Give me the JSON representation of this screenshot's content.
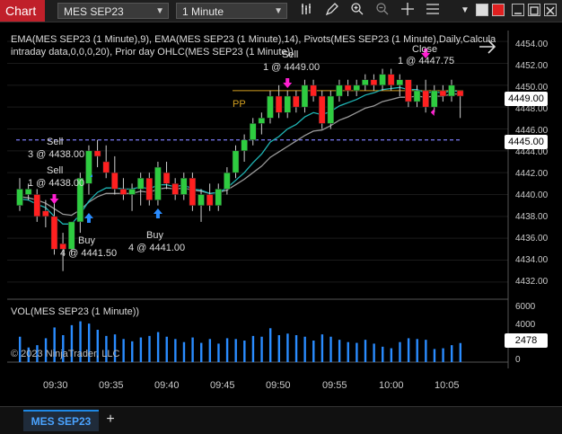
{
  "app": {
    "title": "Chart"
  },
  "toolbar": {
    "instrument": "MES SEP23",
    "interval": "1 Minute"
  },
  "overlays": {
    "indicators_line1": "EMA(MES SEP23 (1 Minute),9), EMA(MES SEP23 (1 Minute),14), Pivots(MES SEP23 (1 Minute),Daily,Calculated from",
    "indicators_line2": "intraday data,0,0,0,20), Prior day OHLC(MES SEP23 (1 Minute))",
    "copyright": "© 2023 NinjaTrader, LLC",
    "vol_label": "VOL(MES SEP23 (1 Minute))",
    "pp_label": "PP"
  },
  "trades": [
    {
      "action": "Sell",
      "detail": "3 @ 4438.00"
    },
    {
      "action": "Sell",
      "detail": "1 @ 4438.00"
    },
    {
      "action": "Buy",
      "detail": "4 @ 4441.50"
    },
    {
      "action": "Buy",
      "detail": "4 @ 4441.00"
    },
    {
      "action": "Sell",
      "detail": "1 @ 4449.00"
    },
    {
      "action": "Close",
      "detail": "1 @ 4447.75"
    }
  ],
  "price_axis": {
    "ticks": [
      "4454.00",
      "4452.00",
      "4450.00",
      "4448.00",
      "4446.00",
      "4444.00",
      "4442.00",
      "4440.00",
      "4438.00",
      "4436.00",
      "4434.00",
      "4432.00"
    ],
    "last_price": "4449.00",
    "level_price": "4445.00"
  },
  "volume_axis": {
    "ticks": [
      "6000",
      "4000",
      "2000",
      "0"
    ],
    "last_volume": "2478"
  },
  "time_axis": [
    "09:30",
    "09:35",
    "09:40",
    "09:45",
    "09:50",
    "09:55",
    "10:00",
    "10:05"
  ],
  "tabs": {
    "active": "MES SEP23",
    "add_label": "+"
  },
  "colors": {
    "up": "#2ecc40",
    "down": "#ff2020",
    "ema_fast": "#1fb5b5",
    "ema_slow": "#9a9a9a",
    "pivot": "#d4a020",
    "prior_level": "#7070e0",
    "sell_arrow": "#ff1fd1",
    "buy_arrow": "#2a8cff",
    "volume": "#2a8cff"
  },
  "chart_data": {
    "type": "candlestick",
    "ylim": [
      4431,
      4455
    ],
    "volume_ylim": [
      0,
      7000
    ],
    "pivot_level": 4449.5,
    "prior_day_level": 4445.0,
    "candles": [
      {
        "o": 4439.0,
        "h": 4441.5,
        "l": 4438.5,
        "c": 4440.5
      },
      {
        "o": 4440.0,
        "h": 4441.0,
        "l": 4439.5,
        "c": 4440.5
      },
      {
        "o": 4440.0,
        "h": 4440.5,
        "l": 4437.5,
        "c": 4438.0
      },
      {
        "o": 4438.5,
        "h": 4439.5,
        "l": 4437.0,
        "c": 4438.0
      },
      {
        "o": 4438.0,
        "h": 4439.5,
        "l": 4434.5,
        "c": 4435.0
      },
      {
        "o": 4435.5,
        "h": 4436.5,
        "l": 4433.0,
        "c": 4435.0
      },
      {
        "o": 4435.0,
        "h": 4437.5,
        "l": 4434.5,
        "c": 4437.5
      },
      {
        "o": 4437.5,
        "h": 4442.0,
        "l": 4436.5,
        "c": 4441.5
      },
      {
        "o": 4441.0,
        "h": 4444.5,
        "l": 4440.0,
        "c": 4444.0
      },
      {
        "o": 4444.0,
        "h": 4445.0,
        "l": 4442.5,
        "c": 4443.5
      },
      {
        "o": 4443.0,
        "h": 4444.5,
        "l": 4441.5,
        "c": 4442.0
      },
      {
        "o": 4442.0,
        "h": 4443.5,
        "l": 4440.0,
        "c": 4440.5
      },
      {
        "o": 4440.5,
        "h": 4441.5,
        "l": 4439.5,
        "c": 4440.0
      },
      {
        "o": 4440.0,
        "h": 4441.0,
        "l": 4438.5,
        "c": 4440.5
      },
      {
        "o": 4440.5,
        "h": 4442.0,
        "l": 4439.0,
        "c": 4441.5
      },
      {
        "o": 4441.5,
        "h": 4442.0,
        "l": 4439.0,
        "c": 4439.5
      },
      {
        "o": 4439.5,
        "h": 4443.0,
        "l": 4439.0,
        "c": 4442.5
      },
      {
        "o": 4442.0,
        "h": 4443.0,
        "l": 4440.5,
        "c": 4441.0
      },
      {
        "o": 4441.0,
        "h": 4441.5,
        "l": 4439.5,
        "c": 4440.0
      },
      {
        "o": 4440.0,
        "h": 4442.0,
        "l": 4439.5,
        "c": 4441.5
      },
      {
        "o": 4441.5,
        "h": 4442.0,
        "l": 4438.5,
        "c": 4439.0
      },
      {
        "o": 4439.0,
        "h": 4440.5,
        "l": 4437.5,
        "c": 4440.0
      },
      {
        "o": 4440.0,
        "h": 4441.0,
        "l": 4438.5,
        "c": 4439.0
      },
      {
        "o": 4439.0,
        "h": 4441.0,
        "l": 4438.5,
        "c": 4440.5
      },
      {
        "o": 4440.5,
        "h": 4442.5,
        "l": 4440.0,
        "c": 4442.0
      },
      {
        "o": 4442.0,
        "h": 4444.5,
        "l": 4441.5,
        "c": 4444.0
      },
      {
        "o": 4444.0,
        "h": 4445.5,
        "l": 4443.0,
        "c": 4445.0
      },
      {
        "o": 4445.0,
        "h": 4447.0,
        "l": 4444.5,
        "c": 4446.5
      },
      {
        "o": 4446.5,
        "h": 4447.5,
        "l": 4445.5,
        "c": 4447.0
      },
      {
        "o": 4447.0,
        "h": 4449.5,
        "l": 4446.5,
        "c": 4449.0
      },
      {
        "o": 4449.0,
        "h": 4450.0,
        "l": 4447.0,
        "c": 4447.5
      },
      {
        "o": 4447.5,
        "h": 4449.5,
        "l": 4447.0,
        "c": 4449.0
      },
      {
        "o": 4449.0,
        "h": 4449.5,
        "l": 4447.5,
        "c": 4448.0
      },
      {
        "o": 4448.0,
        "h": 4450.5,
        "l": 4447.5,
        "c": 4450.0
      },
      {
        "o": 4450.0,
        "h": 4450.5,
        "l": 4448.5,
        "c": 4449.0
      },
      {
        "o": 4449.0,
        "h": 4449.5,
        "l": 4446.0,
        "c": 4446.5
      },
      {
        "o": 4446.5,
        "h": 4449.5,
        "l": 4446.0,
        "c": 4449.0
      },
      {
        "o": 4449.0,
        "h": 4450.5,
        "l": 4448.5,
        "c": 4450.0
      },
      {
        "o": 4450.0,
        "h": 4450.5,
        "l": 4449.0,
        "c": 4449.5
      },
      {
        "o": 4449.5,
        "h": 4450.5,
        "l": 4449.0,
        "c": 4450.0
      },
      {
        "o": 4450.0,
        "h": 4451.0,
        "l": 4449.5,
        "c": 4450.5
      },
      {
        "o": 4450.5,
        "h": 4451.0,
        "l": 4449.5,
        "c": 4450.0
      },
      {
        "o": 4450.0,
        "h": 4451.5,
        "l": 4449.5,
        "c": 4451.0
      },
      {
        "o": 4451.0,
        "h": 4451.5,
        "l": 4449.5,
        "c": 4450.0
      },
      {
        "o": 4450.0,
        "h": 4451.0,
        "l": 4449.0,
        "c": 4450.5
      },
      {
        "o": 4450.5,
        "h": 4450.5,
        "l": 4448.0,
        "c": 4448.5
      },
      {
        "o": 4448.5,
        "h": 4450.0,
        "l": 4448.0,
        "c": 4449.5
      },
      {
        "o": 4449.5,
        "h": 4450.5,
        "l": 4447.5,
        "c": 4448.0
      },
      {
        "o": 4448.0,
        "h": 4450.0,
        "l": 4447.5,
        "c": 4449.5
      },
      {
        "o": 4449.5,
        "h": 4450.0,
        "l": 4448.5,
        "c": 4449.0
      },
      {
        "o": 4449.0,
        "h": 4450.5,
        "l": 4448.5,
        "c": 4450.0
      },
      {
        "o": 4449.5,
        "h": 4449.5,
        "l": 4447.0,
        "c": 4449.0
      }
    ],
    "volumes": [
      3300,
      1900,
      2200,
      3100,
      4500,
      3500,
      4800,
      5300,
      5000,
      4200,
      3400,
      3600,
      3000,
      2700,
      3200,
      3400,
      3900,
      3300,
      3000,
      2600,
      3200,
      2500,
      3000,
      2400,
      3100,
      3000,
      2800,
      3400,
      3300,
      4400,
      3500,
      3700,
      3500,
      3300,
      2800,
      3600,
      3300,
      2900,
      2600,
      2500,
      2900,
      2400,
      2000,
      1800,
      2600,
      3100,
      3000,
      2900,
      1700,
      1800,
      2200,
      2478
    ],
    "ema_fast": [
      4439.6,
      4439.5,
      4439.1,
      4438.8,
      4438.0,
      4437.3,
      4437.3,
      4438.2,
      4439.4,
      4440.2,
      4440.6,
      4440.6,
      4440.5,
      4440.5,
      4440.7,
      4440.5,
      4440.9,
      4440.9,
      4440.7,
      4440.9,
      4440.5,
      4440.4,
      4440.1,
      4440.2,
      4440.6,
      4441.3,
      4442.0,
      4442.9,
      4443.7,
      4444.8,
      4445.3,
      4446.0,
      4446.4,
      4447.1,
      4447.5,
      4447.3,
      4447.6,
      4448.1,
      4448.4,
      4448.7,
      4449.1,
      4449.3,
      4449.6,
      4449.7,
      4449.8,
      4449.6,
      4449.6,
      4449.3,
      4449.4,
      4449.3,
      4449.5,
      4449.4
    ],
    "ema_slow": [
      4439.8,
      4439.7,
      4439.5,
      4439.2,
      4438.7,
      4438.2,
      4438.1,
      4438.6,
      4439.3,
      4439.8,
      4440.1,
      4440.1,
      4440.1,
      4440.1,
      4440.3,
      4440.2,
      4440.5,
      4440.6,
      4440.5,
      4440.6,
      4440.4,
      4440.3,
      4440.1,
      4440.2,
      4440.4,
      4440.9,
      4441.4,
      4442.0,
      4442.6,
      4443.4,
      4443.9,
      4444.4,
      4444.9,
      4445.4,
      4445.8,
      4445.9,
      4446.3,
      4446.8,
      4447.1,
      4447.5,
      4447.9,
      4448.1,
      4448.5,
      4448.7,
      4448.9,
      4448.9,
      4449.0,
      4448.9,
      4449.0,
      4449.0,
      4449.2,
      4449.2
    ]
  }
}
